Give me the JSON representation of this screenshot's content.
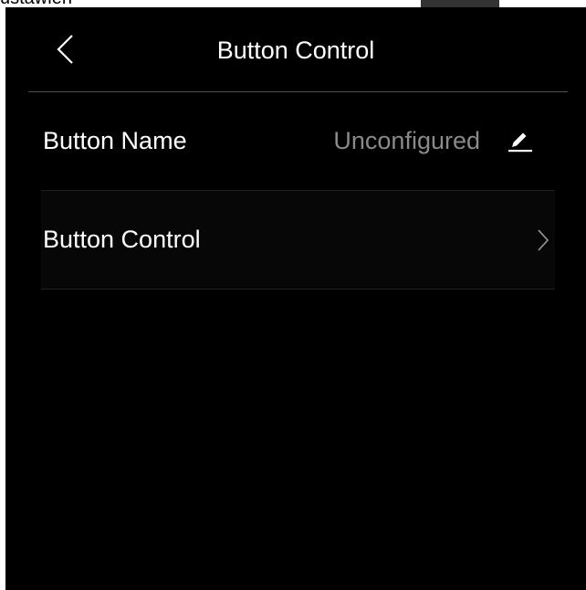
{
  "top_strip": {
    "text": "ustawien"
  },
  "header": {
    "back_icon": "chevron-left-icon",
    "title": "Button Control"
  },
  "rows": [
    {
      "label": "Button Name",
      "value": "Unconfigured",
      "icon": "edit-icon"
    },
    {
      "label": "Button Control",
      "icon": "chevron-right-icon"
    }
  ],
  "colors": {
    "background": "#000000",
    "primary_text": "#ffffff",
    "secondary_text": "#8a8a8a",
    "divider": "#505050"
  }
}
